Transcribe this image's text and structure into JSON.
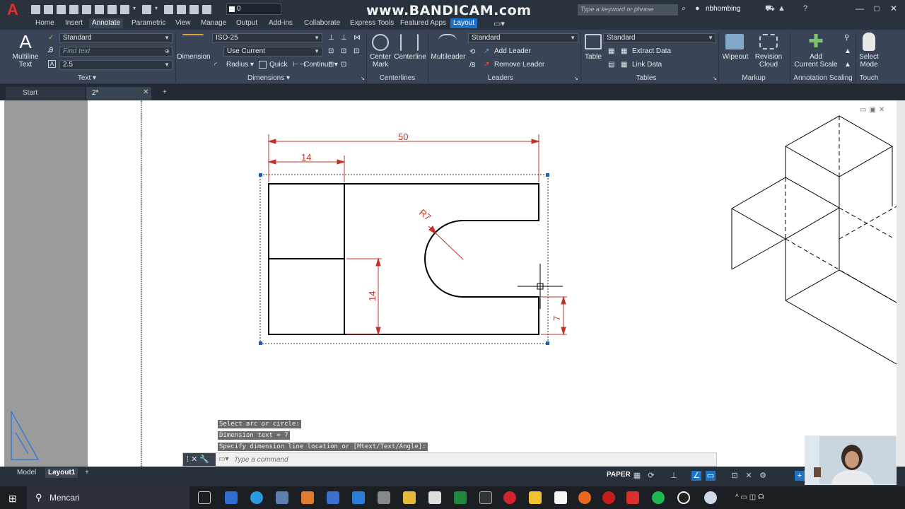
{
  "app": {
    "logo": "A",
    "watermark": "www.BANDICAM.com"
  },
  "titlebar": {
    "layer_value": "0",
    "search_placeholder": "Type a keyword or phrase",
    "username": "nbhombing",
    "window_controls": [
      "—",
      "□",
      "✕"
    ]
  },
  "ribbon_tabs": [
    "Home",
    "Insert",
    "Annotate",
    "Parametric",
    "View",
    "Manage",
    "Output",
    "Add-ins",
    "Collaborate",
    "Express Tools",
    "Featured Apps",
    "Layout"
  ],
  "ribbon": {
    "text_panel": {
      "title": "Text",
      "multiline_label": "Multiline\nText",
      "style_value": "Standard",
      "find_placeholder": "Find text",
      "height_value": "2.5"
    },
    "dimensions_panel": {
      "title": "Dimensions",
      "dimension_label": "Dimension",
      "style_value": "ISO-25",
      "layer_value": "Use Current",
      "radius_label": "Radius",
      "quick_label": "Quick",
      "continue_label": "Continue"
    },
    "centerlines_panel": {
      "title": "Centerlines",
      "center_mark_label": "Center\nMark",
      "centerline_label": "Centerline"
    },
    "leaders_panel": {
      "title": "Leaders",
      "multileader_label": "Multileader",
      "style_value": "Standard",
      "add_label": "Add Leader",
      "remove_label": "Remove Leader"
    },
    "tables_panel": {
      "title": "Tables",
      "table_label": "Table",
      "style_value": "Standard",
      "extract_label": "Extract Data",
      "link_label": "Link Data"
    },
    "markup_panel": {
      "title": "Markup",
      "wipeout_label": "Wipeout",
      "revision_label": "Revision\nCloud"
    },
    "scaling_panel": {
      "title": "Annotation Scaling",
      "add_scale_label": "Add\nCurrent Scale"
    },
    "touch_panel": {
      "title": "Touch",
      "select_mode_label": "Select\nMode"
    }
  },
  "doc_tabs": [
    {
      "label": "Start"
    },
    {
      "label": "2*"
    }
  ],
  "drawing": {
    "dim_overall": "50",
    "dim_left": "14",
    "dim_vertical": "14",
    "dim_radius": "R7",
    "dim_right": "7",
    "line_color": "#000000",
    "dim_color": "#c0332b"
  },
  "command": {
    "history": [
      "Select arc or circle:",
      "Dimension text = 7",
      "Specify dimension line location or [Mtext/Text/Angle]:"
    ],
    "placeholder": "Type a command"
  },
  "status": {
    "layout_tabs": [
      "Model",
      "Layout1"
    ],
    "active_layout": "Layout1",
    "space": "PAPER"
  },
  "taskbar": {
    "search_placeholder": "Mencari"
  }
}
